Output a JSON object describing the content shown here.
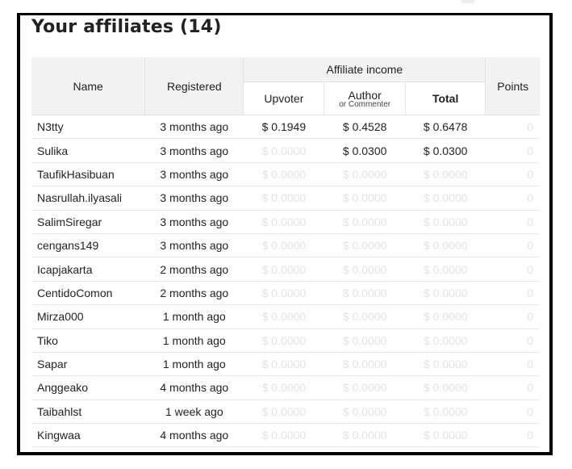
{
  "title": "Your affiliates (14)",
  "columns": {
    "name": "Name",
    "registered": "Registered",
    "affiliate_income": "Affiliate income",
    "upvoter": "Upvoter",
    "author": "Author",
    "author_sub": "or Commenter",
    "total": "Total",
    "points": "Points"
  },
  "rows": [
    {
      "name": "N3tty",
      "registered": "3 months ago",
      "upvoter": "$ 0.1949",
      "author": "$ 0.4528",
      "total": "$ 0.6478",
      "points": "0"
    },
    {
      "name": "Sulika",
      "registered": "3 months ago",
      "upvoter": "$ 0.0000",
      "author": "$ 0.0300",
      "total": "$ 0.0300",
      "points": "0"
    },
    {
      "name": "TaufikHasibuan",
      "registered": "3 months ago",
      "upvoter": "$ 0.0000",
      "author": "$ 0.0000",
      "total": "$ 0.0000",
      "points": "0"
    },
    {
      "name": "Nasrullah.ilyasali",
      "registered": "3 months ago",
      "upvoter": "$ 0.0000",
      "author": "$ 0.0000",
      "total": "$ 0.0000",
      "points": "0"
    },
    {
      "name": "SalimSiregar",
      "registered": "3 months ago",
      "upvoter": "$ 0.0000",
      "author": "$ 0.0000",
      "total": "$ 0.0000",
      "points": "0"
    },
    {
      "name": "cengans149",
      "registered": "3 months ago",
      "upvoter": "$ 0.0000",
      "author": "$ 0.0000",
      "total": "$ 0.0000",
      "points": "0"
    },
    {
      "name": "Icapjakarta",
      "registered": "2 months ago",
      "upvoter": "$ 0.0000",
      "author": "$ 0.0000",
      "total": "$ 0.0000",
      "points": "0"
    },
    {
      "name": "CentidoComon",
      "registered": "2 months ago",
      "upvoter": "$ 0.0000",
      "author": "$ 0.0000",
      "total": "$ 0.0000",
      "points": "0"
    },
    {
      "name": "Mirza000",
      "registered": "1 month ago",
      "upvoter": "$ 0.0000",
      "author": "$ 0.0000",
      "total": "$ 0.0000",
      "points": "0"
    },
    {
      "name": "Tiko",
      "registered": "1 month ago",
      "upvoter": "$ 0.0000",
      "author": "$ 0.0000",
      "total": "$ 0.0000",
      "points": "0"
    },
    {
      "name": "Sapar",
      "registered": "1 month ago",
      "upvoter": "$ 0.0000",
      "author": "$ 0.0000",
      "total": "$ 0.0000",
      "points": "0"
    },
    {
      "name": "Anggeako",
      "registered": "4 months ago",
      "upvoter": "$ 0.0000",
      "author": "$ 0.0000",
      "total": "$ 0.0000",
      "points": "0"
    },
    {
      "name": "Taibahlst",
      "registered": "1 week ago",
      "upvoter": "$ 0.0000",
      "author": "$ 0.0000",
      "total": "$ 0.0000",
      "points": "0"
    },
    {
      "name": "Kingwaa",
      "registered": "4 months ago",
      "upvoter": "$ 0.0000",
      "author": "$ 0.0000",
      "total": "$ 0.0000",
      "points": "0"
    }
  ],
  "colors": {
    "header_bg": "#f2f2f2",
    "zero_value": "#e2e2e2",
    "frame_border": "#000000"
  }
}
